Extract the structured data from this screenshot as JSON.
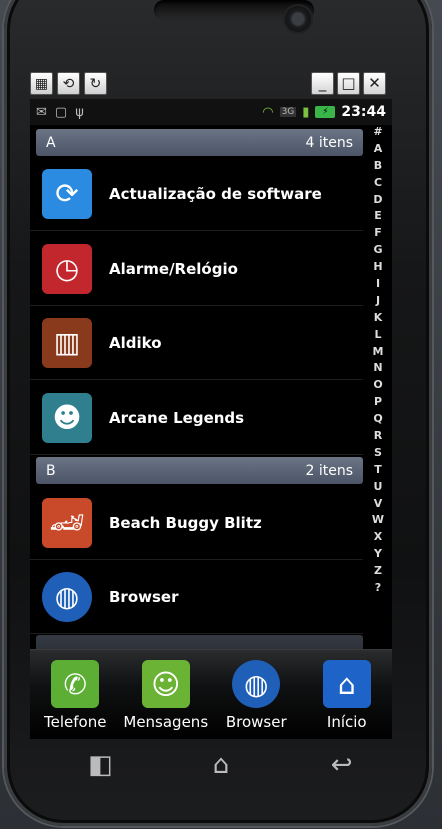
{
  "status": {
    "time": "23:44",
    "network": "3G"
  },
  "sections": [
    {
      "letter": "A",
      "count": "4 itens",
      "apps": [
        {
          "name": "Actualização de software",
          "icon": "update-icon",
          "color": "#2a8be0"
        },
        {
          "name": "Alarme/Relógio",
          "icon": "alarm-clock-icon",
          "color": "#c1272d"
        },
        {
          "name": "Aldiko",
          "icon": "books-icon",
          "color": "#8a3a1c"
        },
        {
          "name": "Arcane Legends",
          "icon": "game-character-icon",
          "color": "#2f7f8f"
        }
      ]
    },
    {
      "letter": "B",
      "count": "2 itens",
      "apps": [
        {
          "name": "Beach Buggy Blitz",
          "icon": "buggy-car-icon",
          "color": "#c84a2a"
        },
        {
          "name": "Browser",
          "icon": "globe-icon",
          "color": "#1f5fb8"
        }
      ]
    }
  ],
  "index_letters": [
    "#",
    "A",
    "B",
    "C",
    "D",
    "E",
    "F",
    "G",
    "H",
    "I",
    "J",
    "K",
    "L",
    "M",
    "N",
    "O",
    "P",
    "Q",
    "R",
    "S",
    "T",
    "U",
    "V",
    "W",
    "X",
    "Y",
    "Z",
    "?"
  ],
  "dock": [
    {
      "label": "Telefone",
      "icon": "phone-icon",
      "color": "#5cae35"
    },
    {
      "label": "Mensagens",
      "icon": "messages-icon",
      "color": "#6bb335"
    },
    {
      "label": "Browser",
      "icon": "globe-icon",
      "color": "#1f5fb8"
    },
    {
      "label": "Início",
      "icon": "home-icon",
      "color": "#1d63c8"
    }
  ]
}
